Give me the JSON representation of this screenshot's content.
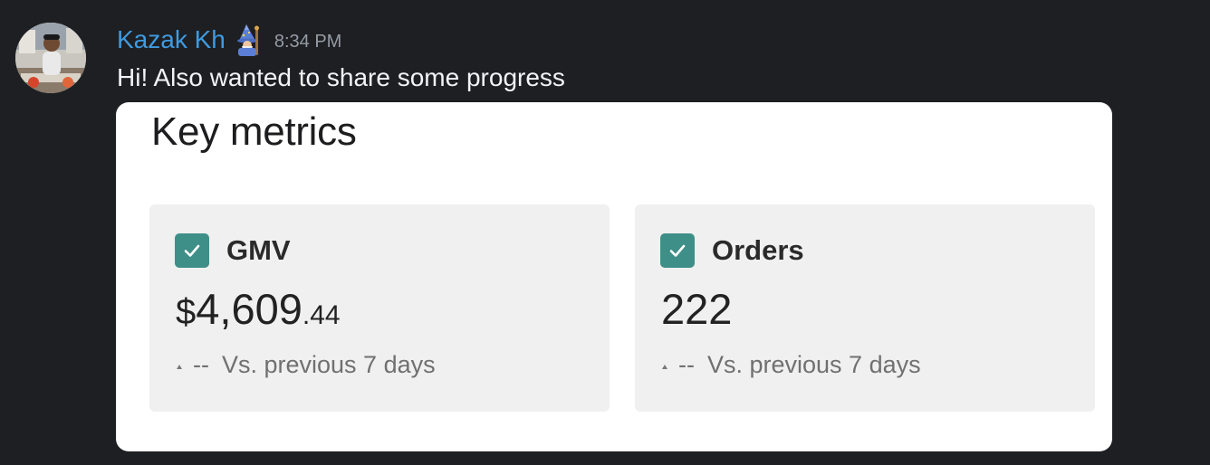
{
  "message": {
    "author": "Kazak Kh",
    "badge_icon": "wizard-icon",
    "timestamp": "8:34 PM",
    "text": "Hi! Also wanted to share some progress"
  },
  "attachment": {
    "title": "Key metrics",
    "cards": [
      {
        "label": "GMV",
        "checked": true,
        "value_currency": "$",
        "value_main": "4,609",
        "value_decimal": ".44",
        "change": "--",
        "comparison": "Vs. previous 7 days"
      },
      {
        "label": "Orders",
        "checked": true,
        "value": "222",
        "change": "--",
        "comparison": "Vs. previous 7 days"
      }
    ]
  },
  "colors": {
    "background": "#1e1f22",
    "username": "#3f9ae0",
    "timestamp": "#949ba4",
    "message_text": "#f2f3f5",
    "checkbox": "#3f8f89",
    "card_bg": "#f0f0f0"
  }
}
